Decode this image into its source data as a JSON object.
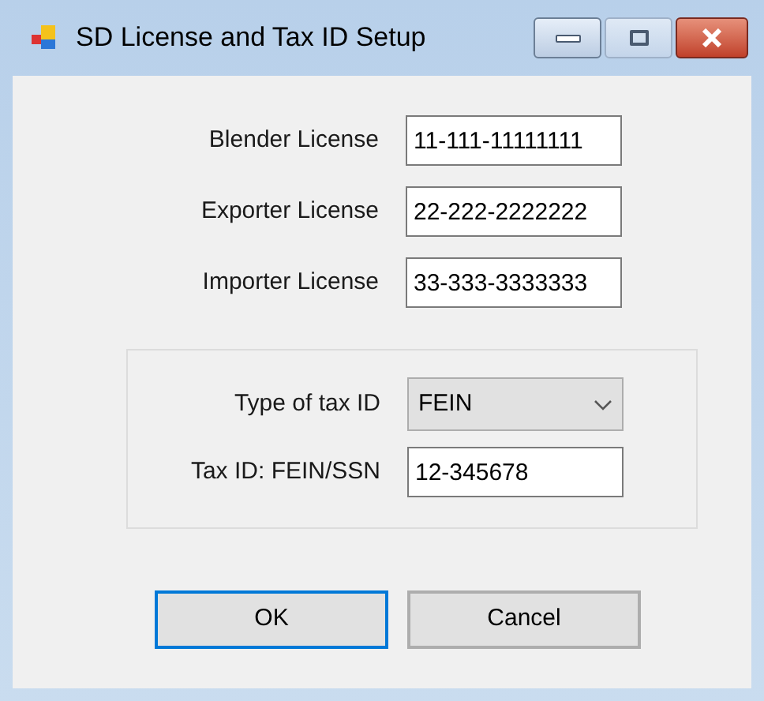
{
  "window": {
    "title": "SD License and Tax ID Setup"
  },
  "licenses": [
    {
      "label": "Blender License",
      "value": "11-111-11111111"
    },
    {
      "label": "Exporter License",
      "value": "22-222-2222222"
    },
    {
      "label": "Importer License",
      "value": "33-333-3333333"
    }
  ],
  "tax_group": {
    "fields": [
      {
        "kind": "dropdown",
        "label": "Type of tax ID",
        "value": "FEIN"
      },
      {
        "kind": "text",
        "label": "Tax ID: FEIN/SSN",
        "value": "12-345678"
      }
    ]
  },
  "buttons": [
    {
      "label": "OK",
      "focused": true
    },
    {
      "label": "Cancel",
      "focused": false
    }
  ]
}
